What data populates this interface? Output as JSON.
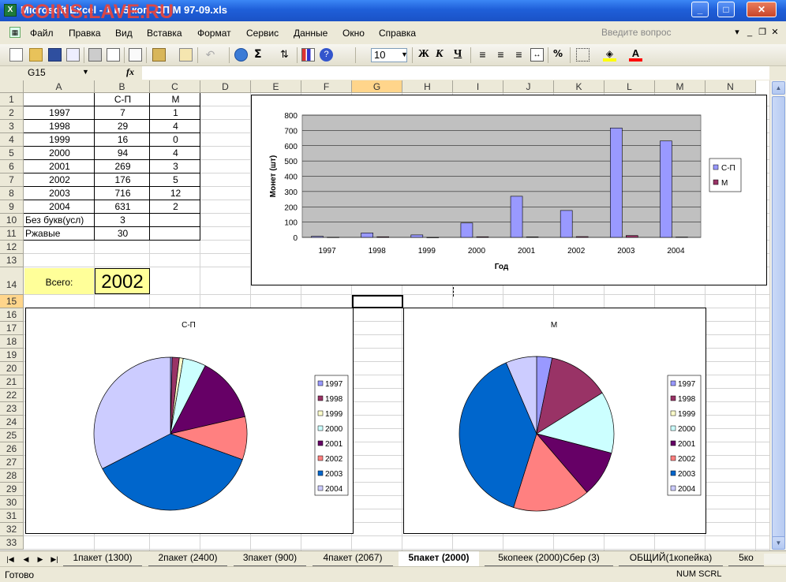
{
  "window": {
    "title": "Microsoft Excel - 1 и 5 коп. СП М 97-09.xls",
    "watermark": "COINS.LAVE.RU"
  },
  "menu": [
    "Файл",
    "Правка",
    "Вид",
    "Вставка",
    "Формат",
    "Сервис",
    "Данные",
    "Окно",
    "Справка"
  ],
  "help_placeholder": "Введите вопрос",
  "toolbar": {
    "font_size": "10",
    "bold": "Ж",
    "italic": "К",
    "underline": "Ч",
    "percent": "%",
    "sigma": "Σ"
  },
  "formula": {
    "namebox": "G15",
    "fx": "fx"
  },
  "columns": [
    "A",
    "B",
    "C",
    "D",
    "E",
    "F",
    "G",
    "H",
    "I",
    "J",
    "K",
    "L",
    "M",
    "N"
  ],
  "rows": [
    "1",
    "2",
    "3",
    "4",
    "5",
    "6",
    "7",
    "8",
    "9",
    "10",
    "11",
    "12",
    "13",
    "14",
    "15",
    "16",
    "17",
    "18",
    "19",
    "20",
    "21",
    "22",
    "23",
    "24",
    "25",
    "26",
    "27",
    "28",
    "29",
    "30",
    "31",
    "32",
    "33"
  ],
  "table": {
    "headers": [
      "",
      "С-П",
      "М"
    ],
    "rows": [
      [
        "1997",
        "7",
        "1"
      ],
      [
        "1998",
        "29",
        "4"
      ],
      [
        "1999",
        "16",
        "0"
      ],
      [
        "2000",
        "94",
        "4"
      ],
      [
        "2001",
        "269",
        "3"
      ],
      [
        "2002",
        "176",
        "5"
      ],
      [
        "2003",
        "716",
        "12"
      ],
      [
        "2004",
        "631",
        "2"
      ],
      [
        "Без букв(усл)",
        "3",
        ""
      ],
      [
        "Ржавые",
        "30",
        ""
      ]
    ]
  },
  "total": {
    "label": "Всего:",
    "value": "2002"
  },
  "colors": {
    "sp": "#9999ff",
    "m": "#993366",
    "grid_bg": "#c0c0c0"
  },
  "chart_data": [
    {
      "type": "bar",
      "categories": [
        "1997",
        "1998",
        "1999",
        "2000",
        "2001",
        "2002",
        "2003",
        "2004"
      ],
      "series": [
        {
          "name": "С-П",
          "values": [
            7,
            29,
            16,
            94,
            269,
            176,
            716,
            631
          ]
        },
        {
          "name": "М",
          "values": [
            1,
            4,
            0,
            4,
            3,
            5,
            12,
            2
          ]
        }
      ],
      "xlabel": "Год",
      "ylabel": "Монет (шт)",
      "ylim": [
        0,
        800
      ],
      "yticks": [
        "0",
        "100",
        "200",
        "300",
        "400",
        "500",
        "600",
        "700",
        "800"
      ],
      "legend": "right",
      "grid": true
    },
    {
      "type": "pie",
      "title": "С-П",
      "categories": [
        "1997",
        "1998",
        "1999",
        "2000",
        "2001",
        "2002",
        "2003",
        "2004"
      ],
      "values": [
        7,
        29,
        16,
        94,
        269,
        176,
        716,
        631
      ],
      "legend": "right"
    },
    {
      "type": "pie",
      "title": "М",
      "categories": [
        "1997",
        "1998",
        "1999",
        "2000",
        "2001",
        "2002",
        "2003",
        "2004"
      ],
      "values": [
        1,
        4,
        0,
        4,
        3,
        5,
        12,
        2
      ],
      "legend": "right"
    }
  ],
  "pie_colors": [
    "#9999ff",
    "#993366",
    "#ffffcc",
    "#ccffff",
    "#660066",
    "#ff8080",
    "#0066cc",
    "#ccccff"
  ],
  "sheet_tabs": [
    "1пакет (1300)",
    "2пакет (2400)",
    "3пакет (900)",
    "4пакет (2067)",
    "5пакет (2000)",
    "5копеек (2000)Сбер (3)",
    "ОБЩИЙ(1копейка)",
    "5ко"
  ],
  "status": {
    "ready": "Готово",
    "indicators": "NUM SCRL"
  }
}
